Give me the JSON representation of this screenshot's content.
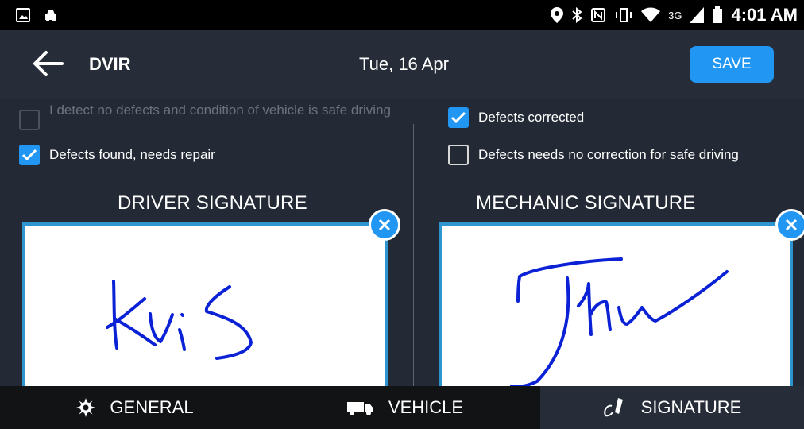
{
  "status_bar": {
    "time": "4:01 AM",
    "network": "3G"
  },
  "toolbar": {
    "title": "DVIR",
    "date": "Tue, 16 Apr",
    "save_label": "SAVE"
  },
  "checks": {
    "no_defects": {
      "label": "I detect no defects and condition of vehicle is safe driving",
      "checked": false,
      "enabled": false
    },
    "defects_found": {
      "label": "Defects found, needs repair",
      "checked": true,
      "enabled": true
    },
    "defects_corrected": {
      "label": "Defects corrected",
      "checked": true,
      "enabled": true
    },
    "no_correction": {
      "label": "Defects needs no correction for safe driving",
      "checked": false,
      "enabled": true
    }
  },
  "signatures": {
    "driver_title": "DRIVER SIGNATURE",
    "driver_signature": "Kris",
    "mechanic_title": "MECHANIC SIGNATURE",
    "mechanic_signature": "John"
  },
  "nav": {
    "general": "GENERAL",
    "vehicle": "VEHICLE",
    "signature": "SIGNATURE",
    "active": "signature"
  },
  "colors": {
    "accent": "#2196f3",
    "background": "#232a35",
    "signature_ink": "#0b21d6"
  }
}
